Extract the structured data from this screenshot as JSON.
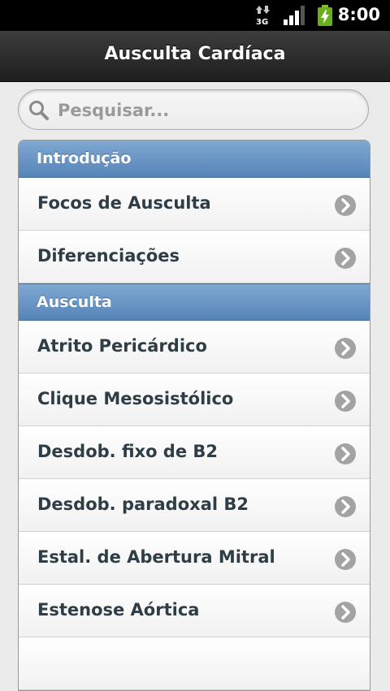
{
  "status_bar": {
    "time": "8:00",
    "network_label": "3G",
    "icons": [
      "data-3g-icon",
      "signal-icon",
      "battery-charging-icon"
    ]
  },
  "header": {
    "title": "Ausculta Cardíaca"
  },
  "search": {
    "placeholder": "Pesquisar..."
  },
  "sections": [
    {
      "title": "Introdução",
      "items": [
        "Focos de Ausculta",
        "Diferenciações"
      ]
    },
    {
      "title": "Ausculta",
      "items": [
        "Atrito Pericárdico",
        "Clique Mesosistólico",
        "Desdob. fixo de B2",
        "Desdob. paradoxal B2",
        "Estal. de Abertura Mitral",
        "Estenose Aórtica"
      ]
    }
  ],
  "colors": {
    "divider": "#5f8cbf",
    "header": "#2a2a2a",
    "item_text": "#2f3e46",
    "arrow": "#a3a3a3"
  }
}
